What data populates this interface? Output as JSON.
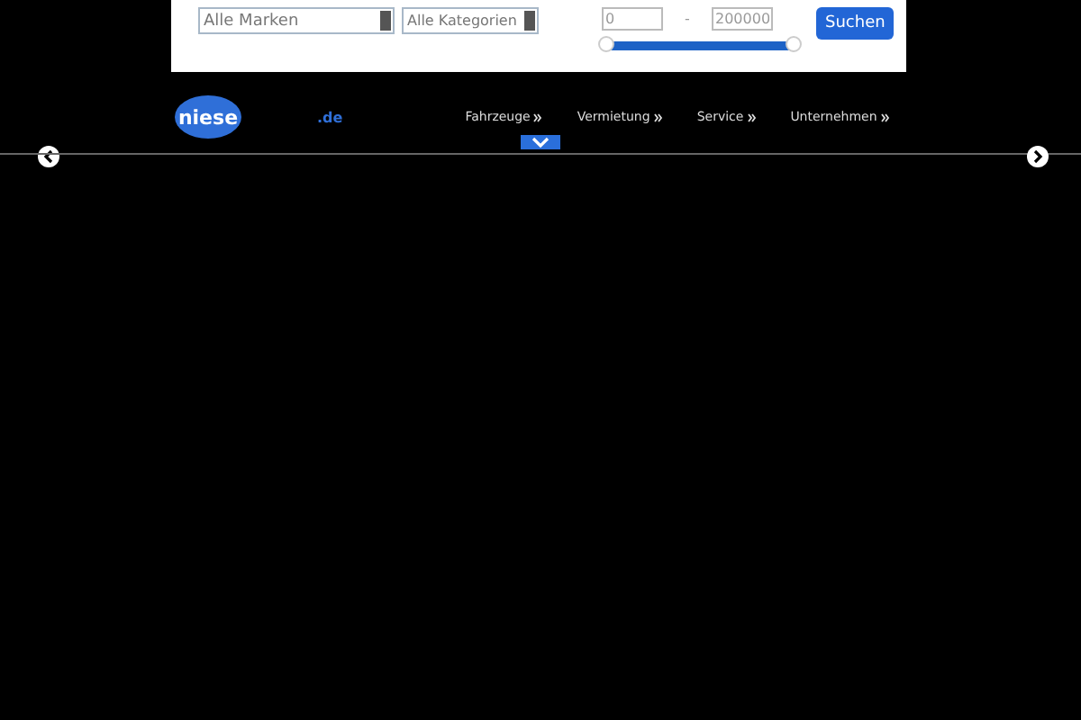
{
  "search_panel": {
    "brand_select": {
      "value": "Alle Marken"
    },
    "category_select": {
      "value": "Alle Kategorien"
    },
    "price_min": {
      "value": "0"
    },
    "price_separator": "-",
    "price_max": {
      "value": "200000"
    },
    "price_slider": {
      "level": 1
    },
    "search_button": "Suchen"
  },
  "header": {
    "logo": "niese",
    "logo_suffix": ".de",
    "nav": [
      "Fahrzeuge",
      "Vermietung",
      "Service",
      "Unternehmen"
    ]
  }
}
